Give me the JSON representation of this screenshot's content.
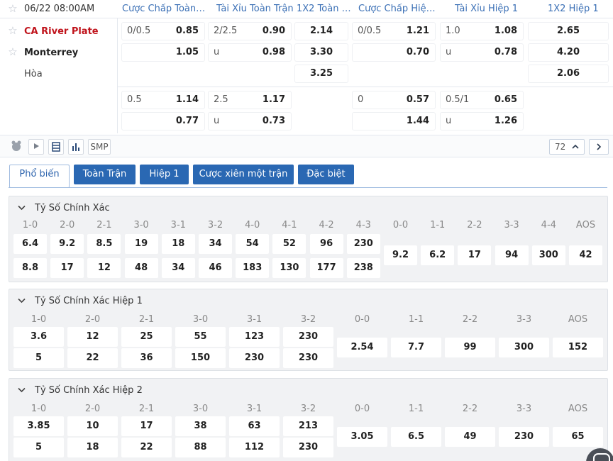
{
  "match": {
    "datetime": "06/22 08:00AM",
    "home": "CA River Plate",
    "away": "Monterrey",
    "draw": "Hòa"
  },
  "columns": [
    "Cược Chấp Toàn T...",
    "Tài Xỉu Toàn Trận",
    "1X2 Toàn T...",
    "Cược Chấp Hiệp 1",
    "Tài Xỉu Hiệp 1",
    "1X2 Hiệp 1"
  ],
  "odds": {
    "r1": {
      "hc_line": "0/0.5",
      "hc_home": "0.85",
      "ou_line": "2/2.5",
      "ou_over": "0.90",
      "x_home": "2.14",
      "h1hc_line": "0/0.5",
      "h1hc_home": "1.21",
      "h1ou_line": "1.0",
      "h1ou_over": "1.08",
      "h1x_home": "2.65"
    },
    "r2": {
      "hc_away": "1.05",
      "ou_u": "u",
      "ou_under": "0.98",
      "x_away": "3.30",
      "h1hc_away": "0.70",
      "h1ou_u": "u",
      "h1ou_under": "0.78",
      "h1x_away": "4.20"
    },
    "r3": {
      "x_draw": "3.25",
      "h1x_draw": "2.06"
    },
    "r4": {
      "hc_line": "0.5",
      "hc_home": "1.14",
      "ou_line": "2.5",
      "ou_over": "1.17",
      "h1hc_line": "0",
      "h1hc_home": "0.57",
      "h1ou_line": "0.5/1",
      "h1ou_over": "0.65"
    },
    "r5": {
      "hc_away": "0.77",
      "ou_u": "u",
      "ou_under": "0.73",
      "h1hc_away": "1.44",
      "h1ou_u": "u",
      "h1ou_under": "1.26"
    }
  },
  "toolbar": {
    "smp_label": "SMP",
    "count": "72"
  },
  "tabs": [
    "Phổ biến",
    "Toàn Trận",
    "Hiệp 1",
    "Cược xiên một trận",
    "Đặc biệt"
  ],
  "sections": [
    {
      "title": "Tỷ Số Chính Xác",
      "labels": [
        "1-0",
        "2-0",
        "2-1",
        "3-0",
        "3-1",
        "3-2",
        "4-0",
        "4-1",
        "4-2",
        "4-3",
        "0-0",
        "1-1",
        "2-2",
        "3-3",
        "4-4",
        "AOS"
      ],
      "home": [
        "6.4",
        "9.2",
        "8.5",
        "19",
        "18",
        "34",
        "54",
        "52",
        "96",
        "230"
      ],
      "away": [
        "8.8",
        "17",
        "12",
        "48",
        "34",
        "46",
        "183",
        "130",
        "177",
        "238"
      ],
      "draws": [
        "9.2",
        "6.2",
        "17",
        "94",
        "300",
        "42"
      ]
    },
    {
      "title": "Tỷ Số Chính Xác Hiệp 1",
      "labels": [
        "1-0",
        "2-0",
        "2-1",
        "3-0",
        "3-1",
        "3-2",
        "0-0",
        "1-1",
        "2-2",
        "3-3",
        "AOS"
      ],
      "home": [
        "3.6",
        "12",
        "25",
        "55",
        "123",
        "230"
      ],
      "away": [
        "5",
        "22",
        "36",
        "150",
        "230",
        "230"
      ],
      "draws": [
        "2.54",
        "7.7",
        "99",
        "300",
        "152"
      ]
    },
    {
      "title": "Tỷ Số Chính Xác Hiệp 2",
      "labels": [
        "1-0",
        "2-0",
        "2-1",
        "3-0",
        "3-1",
        "3-2",
        "0-0",
        "1-1",
        "2-2",
        "3-3",
        "AOS"
      ],
      "home": [
        "3.85",
        "10",
        "17",
        "38",
        "63",
        "213"
      ],
      "away": [
        "5",
        "18",
        "22",
        "88",
        "112",
        "230"
      ],
      "draws": [
        "3.05",
        "6.5",
        "49",
        "230",
        "65"
      ]
    }
  ],
  "colors": {
    "accent": "#2a68b3",
    "home_team": "#c0141c",
    "header_text": "#3a6fb5"
  },
  "icons": [
    "star-icon",
    "lineup-icon",
    "play-icon",
    "scoreboard-icon",
    "stats-icon",
    "chevron-up-icon",
    "chevron-right-icon",
    "caret-down-icon",
    "chat-icon"
  ]
}
